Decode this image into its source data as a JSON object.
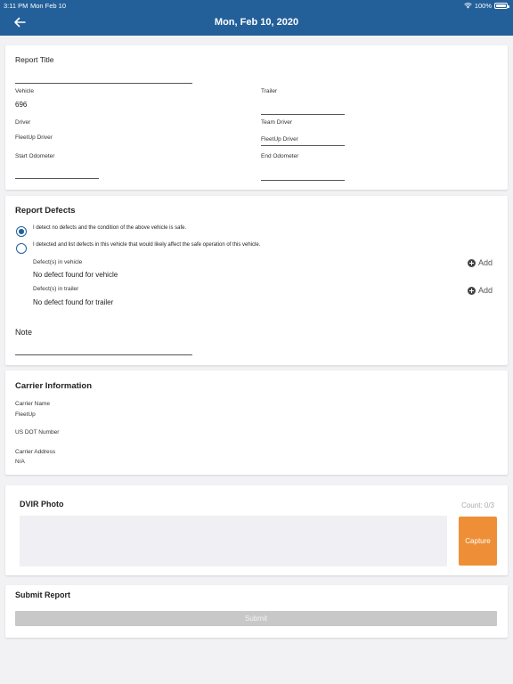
{
  "status_bar": {
    "time": "3:11 PM",
    "date": "Mon Feb 10",
    "battery": "100%"
  },
  "nav": {
    "title": "Mon, Feb 10, 2020"
  },
  "report_info": {
    "report_title_label": "Report Title",
    "vehicle_label": "Vehicle",
    "vehicle_value": "696",
    "trailer_label": "Trailer",
    "driver_label": "Driver",
    "driver_value": "FleetUp Driver",
    "team_driver_label": "Team Driver",
    "team_driver_value": "FleetUp Driver",
    "start_odometer_label": "Start Odometer",
    "end_odometer_label": "End Odometer"
  },
  "defects": {
    "title": "Report Defects",
    "option_no_defects": "I detect no defects and the condition of the above vehicle is safe.",
    "option_defects": "I detected and list defects in this vehicle that would likely affect the safe operation of this vehicle.",
    "selected_option": "no_defects",
    "vehicle_label": "Defect(s) in vehicle",
    "vehicle_value": "No defect found for vehicle",
    "trailer_label": "Defect(s) in trailer",
    "trailer_value": "No defect found for trailer",
    "add_label": "Add",
    "note_label": "Note"
  },
  "carrier": {
    "title": "Carrier Information",
    "name_label": "Carrier Name",
    "name_value": "FleetUp",
    "dot_label": "US DOT Number",
    "address_label": "Carrier Address",
    "address_value": "N/A"
  },
  "photo": {
    "title": "DVIR Photo",
    "count": "Count: 0/3",
    "capture_label": "Capture"
  },
  "submit": {
    "title": "Submit Report",
    "button_label": "Submit"
  },
  "colors": {
    "header": "#23609a",
    "capture": "#ee8f38",
    "submit_disabled": "#c8c8c8"
  },
  "icons": {
    "back": "arrow-left-icon",
    "wifi": "wifi-icon",
    "battery": "battery-icon",
    "add": "plus-circle-icon"
  }
}
